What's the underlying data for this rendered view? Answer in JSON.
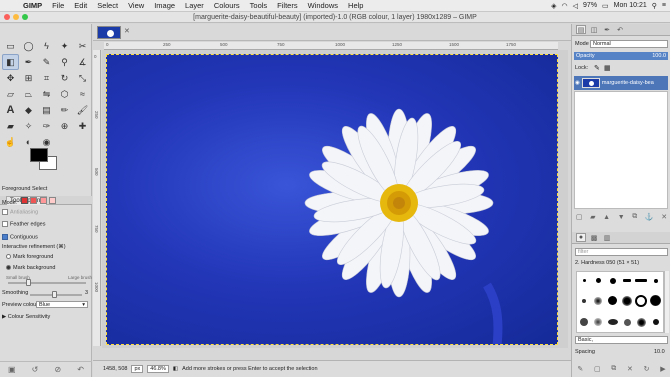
{
  "menubar": {
    "app": "GIMP",
    "items": [
      "File",
      "Edit",
      "Select",
      "View",
      "Image",
      "Layer",
      "Colours",
      "Tools",
      "Filters",
      "Windows",
      "Help"
    ],
    "battery": "97%",
    "clock": "Mon 10:21"
  },
  "window": {
    "title": "[marguerite-daisy-beautiful-beauty] (imported)-1.0 (RGB colour, 1 layer) 1980x1289 – GIMP"
  },
  "toolbox": {
    "tools": [
      "rect-select",
      "ellipse-select",
      "free-select",
      "fuzzy-select",
      "scissors",
      "foreground-select",
      "paths",
      "color-picker",
      "zoom",
      "measure",
      "move",
      "align",
      "crop",
      "rotate",
      "scale",
      "shear",
      "perspective",
      "flip",
      "cage",
      "warp",
      "text",
      "bucket-fill",
      "blend",
      "pencil",
      "paintbrush",
      "eraser",
      "airbrush",
      "ink",
      "clone",
      "heal",
      "smudge",
      "dodge",
      "convolve"
    ],
    "selected_tool": "foreground-select",
    "colors": {
      "fg": "#000000",
      "bg": "#ffffff"
    }
  },
  "tool_options": {
    "tab_label": "Tool Options",
    "heading": "Foreground Select",
    "mode_label": "Mode:",
    "antialiasing": "Antialiasing",
    "feather_edges": "Feather edges",
    "contiguous": "Contiguous",
    "interactive_refinement": "Interactive refinement  (⌘)",
    "mark_foreground": "Mark foreground",
    "mark_background": "Mark background",
    "small_brush": "Small brush",
    "large_brush": "Large brush",
    "smoothing": "Smoothing",
    "smoothing_value": "3",
    "preview_colour_label": "Preview colour",
    "preview_colour_value": "Blue",
    "colour_sensitivity": "Colour Sensitivity"
  },
  "ruler": {
    "h_labels": [
      "0",
      "250",
      "500",
      "750",
      "1000",
      "1250",
      "1500",
      "1750"
    ],
    "v_labels": [
      "0",
      "250",
      "500",
      "750",
      "1000"
    ]
  },
  "status": {
    "coords": "1458, 508",
    "unit": "px",
    "zoom": "46.8%",
    "message": "Add more strokes or press Enter to accept the selection"
  },
  "layers_panel": {
    "mode_label": "Mode",
    "mode_value": "Normal",
    "opacity_label": "Opacity",
    "opacity_value": "100.0",
    "lock_label": "Lock:",
    "layer_name": "marguerite-daisy-bea"
  },
  "brushes_panel": {
    "filter_placeholder": "filter",
    "brush_name": "2. Hardness 050 (51 × 51)",
    "tag_value": "Basic,",
    "spacing_label": "Spacing",
    "spacing_value": "10.0"
  }
}
